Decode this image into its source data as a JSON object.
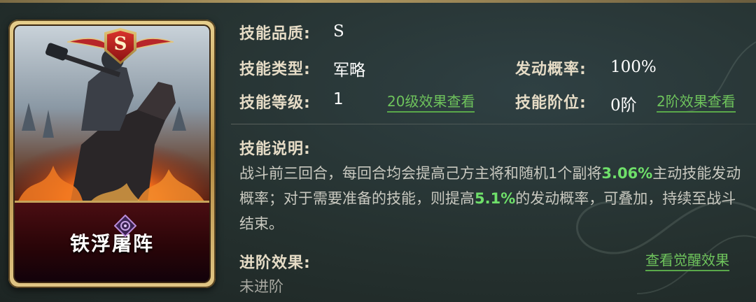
{
  "card": {
    "rank": "S",
    "name": "铁浮屠阵"
  },
  "info": {
    "quality_label": "技能品质:",
    "quality_value": "S",
    "type_label": "技能类型:",
    "type_value": "军略",
    "rate_label": "发动概率:",
    "rate_value": "100%",
    "level_label": "技能等级:",
    "level_value": "1",
    "level_link": "20级效果查看",
    "tier_label": "技能阶位:",
    "tier_value": "0阶",
    "tier_link": "2阶效果查看"
  },
  "description": {
    "label": "技能说明:",
    "part1": "战斗前三回合，每回合均会提高己方主将和随机1个副将",
    "hl1": "3.06%",
    "part2": "主动技能发动概率；对于需要准备的技能，则提高",
    "hl2": "5.1%",
    "part3": "的发动概率，可叠加，持续至战斗结束。"
  },
  "advance": {
    "label": "进阶效果:",
    "value": "未进阶",
    "link": "查看觉醒效果"
  },
  "colors": {
    "highlight": "#6fe06a",
    "link": "#6ec35c",
    "label": "#e6dcc6"
  }
}
